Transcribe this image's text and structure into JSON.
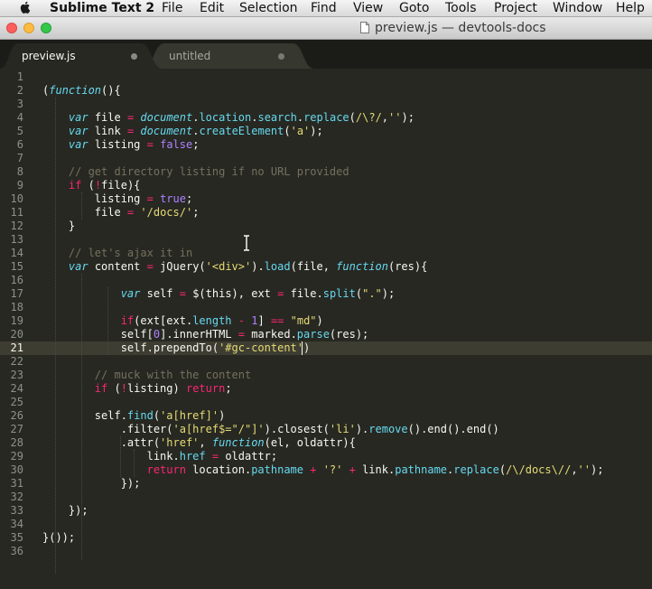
{
  "menubar": {
    "app_name": "Sublime Text 2",
    "items": [
      "File",
      "Edit",
      "Selection",
      "Find",
      "View",
      "Goto",
      "Tools",
      "Project",
      "Window",
      "Help"
    ]
  },
  "window": {
    "title": "preview.js — devtools-docs"
  },
  "tabs": [
    {
      "label": "preview.js",
      "active": true
    },
    {
      "label": "untitled",
      "active": false
    }
  ],
  "editor": {
    "current_line": 21,
    "lines": [
      [],
      [
        [
          "pl",
          "("
        ],
        [
          "sv",
          "function"
        ],
        [
          "pl",
          "(){"
        ]
      ],
      [],
      [
        [
          "pl",
          "    "
        ],
        [
          "sv",
          "var"
        ],
        [
          "pl",
          " file "
        ],
        [
          "kw",
          "="
        ],
        [
          "pl",
          " "
        ],
        [
          "sv",
          "document"
        ],
        [
          "pl",
          "."
        ],
        [
          "fn",
          "location"
        ],
        [
          "pl",
          "."
        ],
        [
          "fn",
          "search"
        ],
        [
          "pl",
          "."
        ],
        [
          "fn",
          "replace"
        ],
        [
          "pl",
          "("
        ],
        [
          "st",
          "/\\?/"
        ],
        [
          "pl",
          ","
        ],
        [
          "st",
          "''"
        ],
        [
          "pl",
          ");"
        ]
      ],
      [
        [
          "pl",
          "    "
        ],
        [
          "sv",
          "var"
        ],
        [
          "pl",
          " link "
        ],
        [
          "kw",
          "="
        ],
        [
          "pl",
          " "
        ],
        [
          "sv",
          "document"
        ],
        [
          "pl",
          "."
        ],
        [
          "fn",
          "createElement"
        ],
        [
          "pl",
          "("
        ],
        [
          "st",
          "'a'"
        ],
        [
          "pl",
          ");"
        ]
      ],
      [
        [
          "pl",
          "    "
        ],
        [
          "sv",
          "var"
        ],
        [
          "pl",
          " listing "
        ],
        [
          "kw",
          "="
        ],
        [
          "pl",
          " "
        ],
        [
          "nm",
          "false"
        ],
        [
          "pl",
          ";"
        ]
      ],
      [],
      [
        [
          "pl",
          "    "
        ],
        [
          "cm",
          "// get directory listing if no URL provided"
        ]
      ],
      [
        [
          "pl",
          "    "
        ],
        [
          "kw",
          "if"
        ],
        [
          "pl",
          " ("
        ],
        [
          "kw",
          "!"
        ],
        [
          "pl",
          "file){"
        ]
      ],
      [
        [
          "pl",
          "        listing "
        ],
        [
          "kw",
          "="
        ],
        [
          "pl",
          " "
        ],
        [
          "nm",
          "true"
        ],
        [
          "pl",
          ";"
        ]
      ],
      [
        [
          "pl",
          "        file "
        ],
        [
          "kw",
          "="
        ],
        [
          "pl",
          " "
        ],
        [
          "st",
          "'/docs/'"
        ],
        [
          "pl",
          ";"
        ]
      ],
      [
        [
          "pl",
          "    }"
        ]
      ],
      [],
      [
        [
          "pl",
          "    "
        ],
        [
          "cm",
          "// let's ajax it in"
        ]
      ],
      [
        [
          "pl",
          "    "
        ],
        [
          "sv",
          "var"
        ],
        [
          "pl",
          " content "
        ],
        [
          "kw",
          "="
        ],
        [
          "pl",
          " jQuery("
        ],
        [
          "st",
          "'<div>'"
        ],
        [
          "pl",
          ")."
        ],
        [
          "fn",
          "load"
        ],
        [
          "pl",
          "(file, "
        ],
        [
          "sv",
          "function"
        ],
        [
          "pl",
          "(res){"
        ]
      ],
      [],
      [
        [
          "pl",
          "            "
        ],
        [
          "sv",
          "var"
        ],
        [
          "pl",
          " self "
        ],
        [
          "kw",
          "="
        ],
        [
          "pl",
          " $(this), ext "
        ],
        [
          "kw",
          "="
        ],
        [
          "pl",
          " file."
        ],
        [
          "fn",
          "split"
        ],
        [
          "pl",
          "("
        ],
        [
          "st",
          "\".\""
        ],
        [
          "pl",
          ");"
        ]
      ],
      [],
      [
        [
          "pl",
          "            "
        ],
        [
          "kw",
          "if"
        ],
        [
          "pl",
          "(ext[ext."
        ],
        [
          "fn",
          "length"
        ],
        [
          "pl",
          " "
        ],
        [
          "kw",
          "-"
        ],
        [
          "pl",
          " "
        ],
        [
          "nm",
          "1"
        ],
        [
          "pl",
          "] "
        ],
        [
          "kw",
          "=="
        ],
        [
          "pl",
          " "
        ],
        [
          "st",
          "\"md\""
        ],
        [
          "pl",
          ")"
        ]
      ],
      [
        [
          "pl",
          "            self["
        ],
        [
          "nm",
          "0"
        ],
        [
          "pl",
          "].innerHTML "
        ],
        [
          "kw",
          "="
        ],
        [
          "pl",
          " marked."
        ],
        [
          "fn",
          "parse"
        ],
        [
          "pl",
          "(res);"
        ]
      ],
      [
        [
          "pl",
          "            self.prependTo("
        ],
        [
          "st",
          "'#gc-content'"
        ],
        [
          "pl",
          ")"
        ]
      ],
      [],
      [
        [
          "pl",
          "        "
        ],
        [
          "cm",
          "// muck with the content"
        ]
      ],
      [
        [
          "pl",
          "        "
        ],
        [
          "kw",
          "if"
        ],
        [
          "pl",
          " ("
        ],
        [
          "kw",
          "!"
        ],
        [
          "pl",
          "listing) "
        ],
        [
          "kw",
          "return"
        ],
        [
          "pl",
          ";"
        ]
      ],
      [],
      [
        [
          "pl",
          "        self."
        ],
        [
          "fn",
          "find"
        ],
        [
          "pl",
          "("
        ],
        [
          "st",
          "'a[href]'"
        ],
        [
          "pl",
          ")"
        ]
      ],
      [
        [
          "pl",
          "            .filter("
        ],
        [
          "st",
          "'a[href$=\"/\"]'"
        ],
        [
          "pl",
          ").closest("
        ],
        [
          "st",
          "'li'"
        ],
        [
          "pl",
          ")."
        ],
        [
          "fn",
          "remove"
        ],
        [
          "pl",
          "().end().end()"
        ]
      ],
      [
        [
          "pl",
          "            .attr("
        ],
        [
          "st",
          "'href'"
        ],
        [
          "pl",
          ", "
        ],
        [
          "sv",
          "function"
        ],
        [
          "pl",
          "(el, oldattr){"
        ]
      ],
      [
        [
          "pl",
          "                link."
        ],
        [
          "fn",
          "href"
        ],
        [
          "pl",
          " "
        ],
        [
          "kw",
          "="
        ],
        [
          "pl",
          " oldattr;"
        ]
      ],
      [
        [
          "pl",
          "                "
        ],
        [
          "kw",
          "return"
        ],
        [
          "pl",
          " location."
        ],
        [
          "fn",
          "pathname"
        ],
        [
          "pl",
          " "
        ],
        [
          "kw",
          "+"
        ],
        [
          "pl",
          " "
        ],
        [
          "st",
          "'?'"
        ],
        [
          "pl",
          " "
        ],
        [
          "kw",
          "+"
        ],
        [
          "pl",
          " link."
        ],
        [
          "fn",
          "pathname"
        ],
        [
          "pl",
          "."
        ],
        [
          "fn",
          "replace"
        ],
        [
          "pl",
          "("
        ],
        [
          "st",
          "/\\/docs\\//"
        ],
        [
          "pl",
          ","
        ],
        [
          "st",
          "''"
        ],
        [
          "pl",
          ");"
        ]
      ],
      [
        [
          "pl",
          "            });"
        ]
      ],
      [],
      [
        [
          "pl",
          "    });"
        ]
      ],
      [],
      [
        [
          "pl",
          "}());"
        ]
      ],
      []
    ]
  }
}
